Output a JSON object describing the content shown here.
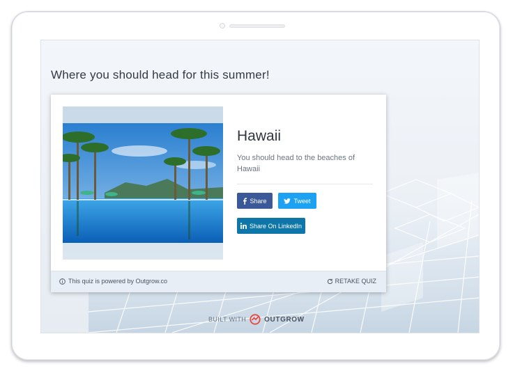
{
  "page": {
    "title": "Where you should head for this summer!"
  },
  "result": {
    "title": "Hawaii",
    "description": "You should head to the beaches of Hawaii"
  },
  "share": {
    "facebook_label": "Share",
    "twitter_label": "Tweet",
    "linkedin_label": "Share On LinkedIn"
  },
  "footer": {
    "powered_text": "This quiz is powered by Outgrow.co",
    "retake_label": "RETAKE QUIZ"
  },
  "branding": {
    "built_with": "BUILT WITH",
    "brand_name": "OUTGROW"
  },
  "colors": {
    "facebook": "#3b5998",
    "twitter": "#1da1f2",
    "linkedin": "#0e76a8",
    "brand": "#e8453c"
  },
  "icons": [
    "facebook-icon",
    "twitter-icon",
    "linkedin-icon",
    "info-icon",
    "retake-icon",
    "outgrow-logo-icon"
  ]
}
